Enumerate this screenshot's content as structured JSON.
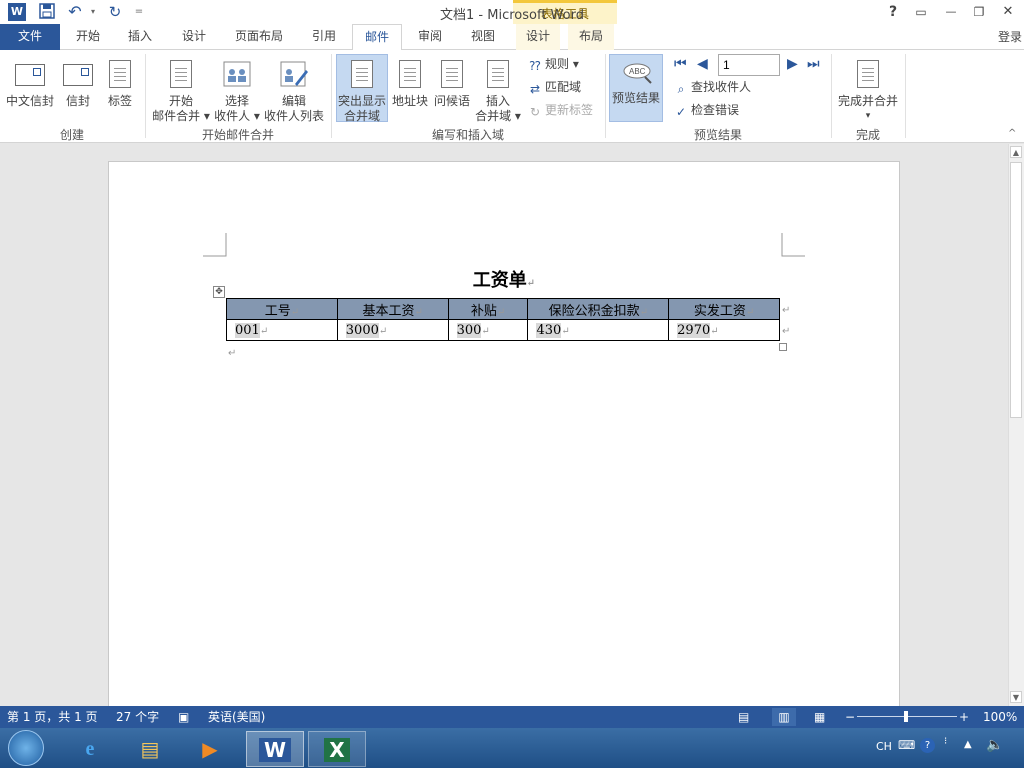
{
  "window": {
    "title": "文档1 - Microsoft Word",
    "context_tab_title": "表格工具",
    "help": "?",
    "restore_ribbon": "▭",
    "minimize": "—",
    "maximize": "❐",
    "close": "✕"
  },
  "qat": {
    "word_icon": "W",
    "save_icon": "💾",
    "undo": "↶",
    "redo": "↻",
    "customize": "="
  },
  "tabs": [
    "文件",
    "开始",
    "插入",
    "设计",
    "页面布局",
    "引用",
    "邮件",
    "审阅",
    "视图",
    "设计",
    "布局"
  ],
  "active_tab": "邮件",
  "login": "登录",
  "ribbon": {
    "groups": {
      "create": "创建",
      "start_merge": "开始邮件合并",
      "write_insert": "编写和插入域",
      "preview": "预览结果",
      "finish": "完成"
    },
    "create": {
      "envelopes_cn": "中文信封",
      "envelopes": "信封",
      "labels": "标签"
    },
    "start_merge": {
      "start_l1": "开始",
      "start_l2": "邮件合并 ▾",
      "select_l1": "选择",
      "select_l2": "收件人 ▾",
      "edit_l1": "编辑",
      "edit_l2": "收件人列表"
    },
    "write_insert": {
      "highlight_l1": "突出显示",
      "highlight_l2": "合并域",
      "address": "地址块",
      "greeting": "问候语",
      "insert_l1": "插入",
      "insert_l2": "合并域 ▾",
      "rules": "规则 ▾",
      "match_fields": "匹配域",
      "update_labels": "更新标签"
    },
    "preview": {
      "preview_results": "预览结果",
      "record_value": "1",
      "find_recipient": "查找收件人",
      "check_errors": "检查错误"
    },
    "finish": {
      "finish_merge_l1": "完成并合并",
      "finish_merge_l2": "▾"
    }
  },
  "document": {
    "title": "工资单",
    "table": {
      "headers": [
        "工号",
        "基本工资",
        "补贴",
        "保险公积金扣款",
        "实发工资"
      ],
      "rows": [
        [
          "001",
          "3000",
          "300",
          "430",
          "2970"
        ]
      ]
    }
  },
  "status": {
    "page": "第 1 页，共 1 页",
    "words": "27 个字",
    "language": "英语(美国)",
    "zoom": "100%",
    "zoom_level": 1.0
  },
  "taskbar": {
    "ime": "CH"
  },
  "colors": {
    "word_blue": "#2b579a",
    "table_header": "#8497b0",
    "context_band": "#f3c73b"
  }
}
